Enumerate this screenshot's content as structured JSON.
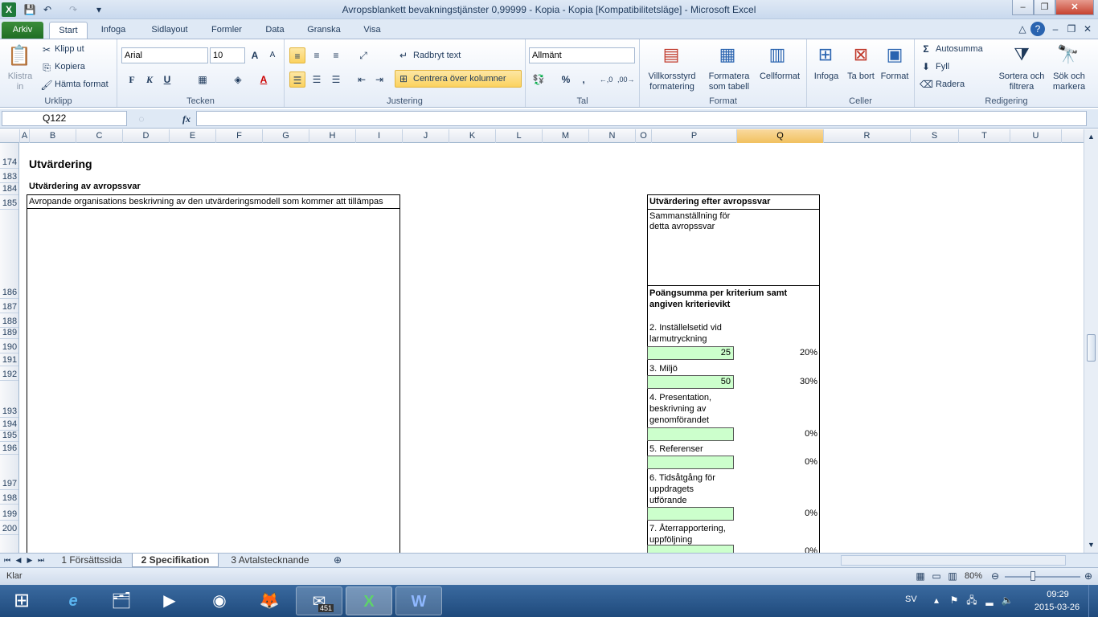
{
  "app": {
    "title": "Avropsblankett bevakningstjänster 0,99999 - Kopia - Kopia  [Kompatibilitetsläge]  -  Microsoft Excel"
  },
  "tabs": [
    "Arkiv",
    "Start",
    "Infoga",
    "Sidlayout",
    "Formler",
    "Data",
    "Granska",
    "Visa"
  ],
  "ribbon": {
    "clipboard": {
      "paste": "Klistra in",
      "cut": "Klipp ut",
      "copy": "Kopiera",
      "format_painter": "Hämta format",
      "label": "Urklipp"
    },
    "font": {
      "name": "Arial",
      "size": "10",
      "bold": "F",
      "italic": "K",
      "underline": "U",
      "label": "Tecken"
    },
    "alignment": {
      "wrap": "Radbryt text",
      "merge": "Centrera över kolumner",
      "label": "Justering"
    },
    "number": {
      "format": "Allmänt",
      "percent": "%",
      "comma": ",",
      "label": "Tal"
    },
    "styles": {
      "conditional": "Villkorsstyrd formatering",
      "as_table": "Formatera som tabell",
      "cell_styles": "Cellformat",
      "label": "Format"
    },
    "cells": {
      "insert": "Infoga",
      "delete": "Ta bort",
      "format": "Format",
      "label": "Celler"
    },
    "editing": {
      "autosum": "Autosumma",
      "fill": "Fyll",
      "clear": "Radera",
      "sort": "Sortera och filtrera",
      "find": "Sök och markera",
      "label": "Redigering"
    }
  },
  "formula_bar": {
    "name_box": "Q122",
    "fx": "fx",
    "value": ""
  },
  "columns": [
    "A",
    "B",
    "C",
    "D",
    "E",
    "F",
    "G",
    "H",
    "I",
    "J",
    "K",
    "L",
    "M",
    "N",
    "O",
    "P",
    "Q",
    "R",
    "S",
    "T",
    "U"
  ],
  "selected_column": "Q",
  "rows": [
    "174",
    "183",
    "184",
    "185",
    "186",
    "187",
    "188",
    "189",
    "190",
    "191",
    "192",
    "193",
    "194",
    "195",
    "196",
    "197",
    "198",
    "199",
    "200"
  ],
  "sheet": {
    "heading": "Utvärdering",
    "subheading": "Utvärdering av avropssvar",
    "left_box_title": "Avropande organisations beskrivning av den utvärderingsmodell som kommer att tillämpas",
    "right_box_title": "Utvärdering efter avropssvar",
    "summary_label": "Sammanställning för detta avropssvar",
    "points_heading": "Poängsumma per kriterium samt angiven kriterievikt",
    "criteria": [
      {
        "label": "2. Inställelsetid vid larmutryckning",
        "score": "25",
        "weight": "20%"
      },
      {
        "label": "3. Miljö",
        "score": "50",
        "weight": "30%"
      },
      {
        "label": "4. Presentation, beskrivning av genomförandet",
        "score": "",
        "weight": "0%"
      },
      {
        "label": "5. Referenser",
        "score": "",
        "weight": "0%"
      },
      {
        "label": "6. Tidsåtgång för uppdragets utförande",
        "score": "",
        "weight": "0%"
      },
      {
        "label": "7. Återrapportering, uppföljning",
        "score": "",
        "weight": "0%"
      }
    ]
  },
  "sheet_tabs": [
    "1 Försättssida",
    "2 Specifikation",
    "3 Avtalstecknande"
  ],
  "active_sheet": "2 Specifikation",
  "status": {
    "ready": "Klar",
    "zoom": "80%"
  },
  "taskbar": {
    "lang": "SV",
    "time": "09:29",
    "date": "2015-03-26",
    "mail_badge": "451"
  }
}
